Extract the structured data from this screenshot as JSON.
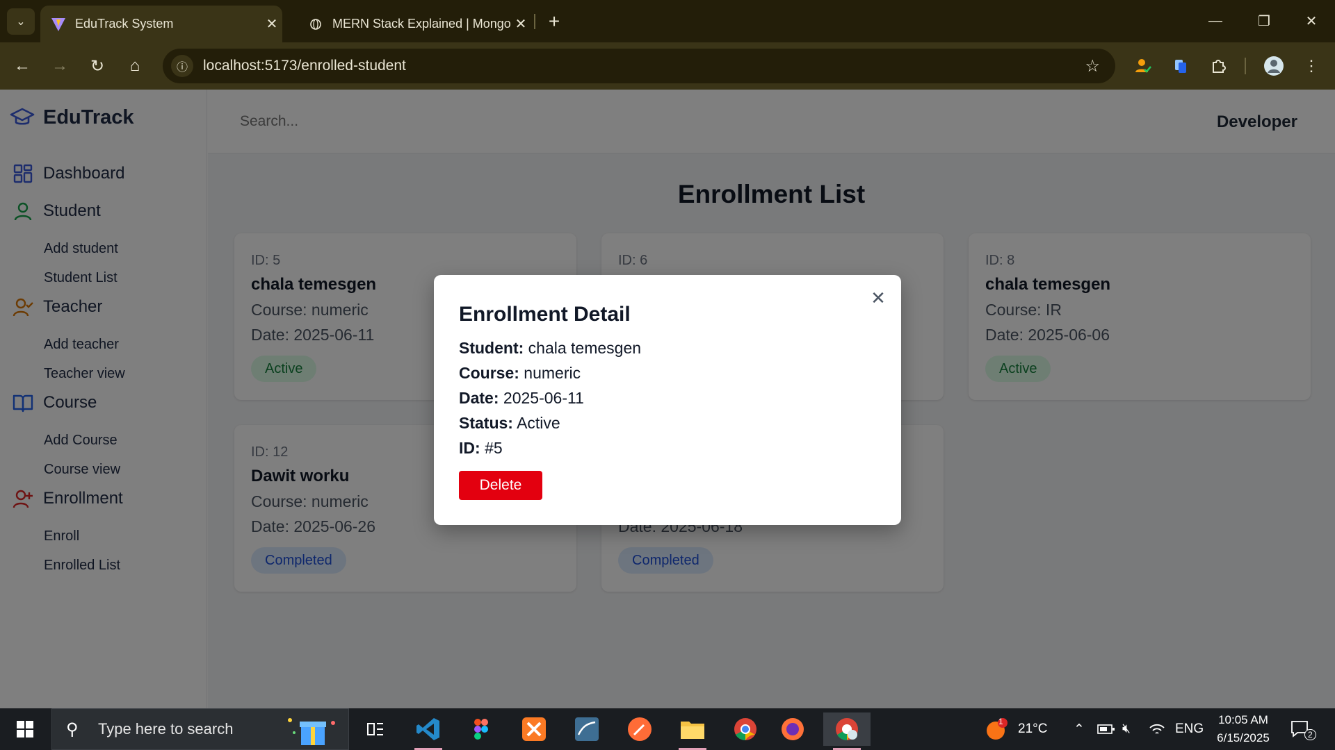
{
  "browser": {
    "tabs": [
      {
        "title": "EduTrack System",
        "active": true
      },
      {
        "title": "MERN Stack Explained | Mongo",
        "active": false
      }
    ],
    "url": "localhost:5173/enrolled-student"
  },
  "sidebar": {
    "brand": "EduTrack",
    "groups": [
      {
        "label": "Dashboard",
        "icon": "grid-icon",
        "items": []
      },
      {
        "label": "Student",
        "icon": "user-icon",
        "items": [
          "Add student",
          "Student List"
        ]
      },
      {
        "label": "Teacher",
        "icon": "user-check-icon",
        "items": [
          "Add teacher",
          "Teacher view"
        ]
      },
      {
        "label": "Course",
        "icon": "book-icon",
        "items": [
          "Add Course",
          "Course view"
        ]
      },
      {
        "label": "Enrollment",
        "icon": "user-plus-icon",
        "items": [
          "Enroll",
          "Enrolled List"
        ]
      }
    ]
  },
  "header": {
    "search_placeholder": "Search...",
    "user": "Developer"
  },
  "main": {
    "title": "Enrollment List",
    "cards": [
      {
        "id": "ID: 5",
        "name": "chala temesgen",
        "course": "Course: numeric",
        "date": "Date: 2025-06-11",
        "status": "Active"
      },
      {
        "id": "ID: 6",
        "name": "",
        "course": "",
        "date": "",
        "status": ""
      },
      {
        "id": "ID: 8",
        "name": "chala temesgen",
        "course": "Course: IR",
        "date": "Date: 2025-06-06",
        "status": "Active"
      },
      {
        "id": "ID: 12",
        "name": "Dawit worku",
        "course": "Course: numeric",
        "date": "Date: 2025-06-26",
        "status": "Completed"
      },
      {
        "id": "",
        "name": "",
        "course": "",
        "date": "Date: 2025-06-18",
        "status": "Completed"
      }
    ]
  },
  "modal": {
    "title": "Enrollment Detail",
    "rows": [
      {
        "label": "Student:",
        "value": "chala temesgen"
      },
      {
        "label": "Course:",
        "value": "numeric"
      },
      {
        "label": "Date:",
        "value": "2025-06-11"
      },
      {
        "label": "Status:",
        "value": "Active"
      },
      {
        "label": "ID:",
        "value": "#5"
      }
    ],
    "delete_label": "Delete"
  },
  "taskbar": {
    "search_placeholder": "Type here to search",
    "weather": "21°C",
    "weather_badge": "1",
    "language": "ENG",
    "time": "10:05 AM",
    "date": "6/15/2025",
    "notifications": "2"
  },
  "colors": {
    "accent": "#1f2a44",
    "delete": "#e3000f",
    "active_badge_bg": "#dcfce7",
    "completed_badge_bg": "#dbeafe"
  }
}
